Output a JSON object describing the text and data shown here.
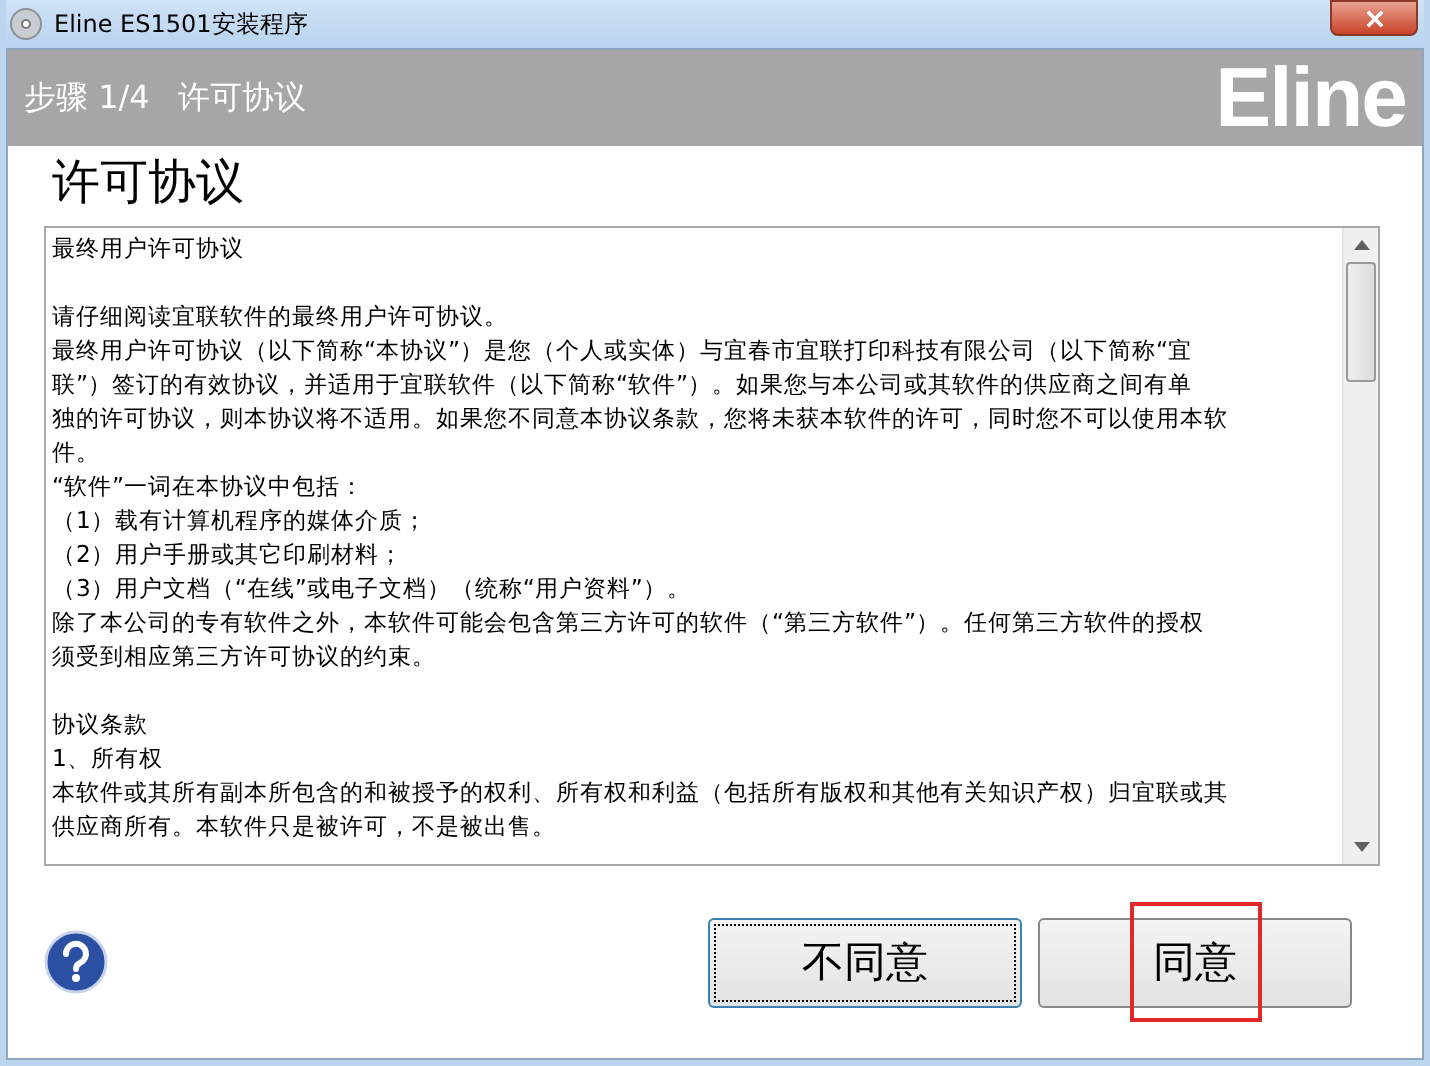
{
  "window": {
    "title": "Eline ES1501安装程序"
  },
  "header": {
    "step": "步骤 1/4",
    "step_title": "许可协议",
    "logo": "Eline"
  },
  "page_title": "许可协议",
  "license": {
    "paragraphs": [
      {
        "lines": [
          "最终用户许可协议"
        ]
      },
      {
        "lines": [
          "请仔细阅读宜联软件的最终用户许可协议。",
          "最终用户许可协议（以下简称“本协议”）是您（个人或实体）与宜春市宜联打印科技有限公司（以下简称“宜",
          "联”）签订的有效协议，并适用于宜联软件（以下简称“软件”）。如果您与本公司或其软件的供应商之间有单",
          "独的许可协议，则本协议将不适用。如果您不同意本协议条款，您将未获本软件的许可，同时您不可以使用本软",
          "件。",
          "“软件”一词在本协议中包括：",
          "（1）载有计算机程序的媒体介质；",
          "（2）用户手册或其它印刷材料；",
          "（3）用户文档（“在线”或电子文档）（统称“用户资料”）。",
          "除了本公司的专有软件之外，本软件可能会包含第三方许可的软件（“第三方软件”）。任何第三方软件的授权",
          "须受到相应第三方许可协议的约束。"
        ]
      },
      {
        "lines": [
          "协议条款",
          "1、所有权",
          "本软件或其所有副本所包含的和被授予的权利、所有权和利益（包括所有版权和其他有关知识产权）归宜联或其",
          "供应商所有。本软件只是被许可，不是被出售。"
        ]
      }
    ]
  },
  "buttons": [
    {
      "label": "不同意",
      "focused": true,
      "highlighted": false
    },
    {
      "label": "同意",
      "focused": false,
      "highlighted": true
    }
  ]
}
